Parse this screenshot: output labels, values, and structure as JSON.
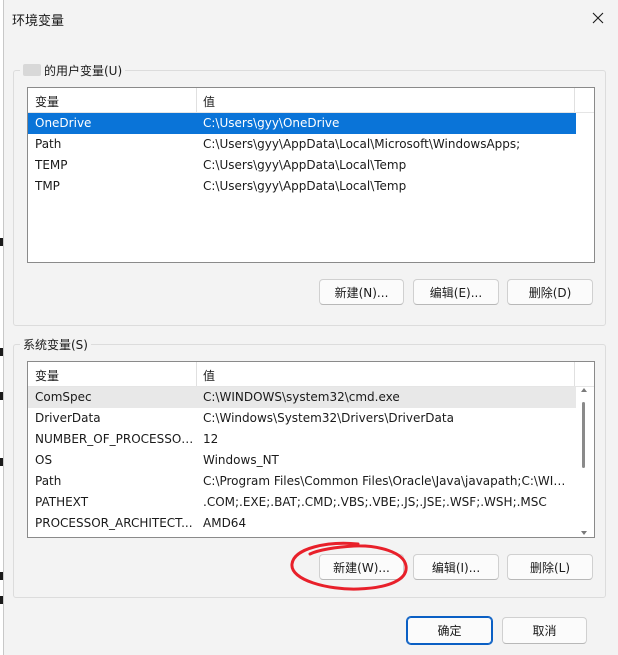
{
  "dialog": {
    "title": "环境变量"
  },
  "user_group": {
    "legend": "的用户变量(U)"
  },
  "system_group": {
    "legend": "系统变量(S)"
  },
  "columns": {
    "variable": "变量",
    "value": "值"
  },
  "user_vars": [
    {
      "name": "OneDrive",
      "value": "C:\\Users\\gyy\\OneDrive"
    },
    {
      "name": "Path",
      "value": "C:\\Users\\gyy\\AppData\\Local\\Microsoft\\WindowsApps;"
    },
    {
      "name": "TEMP",
      "value": "C:\\Users\\gyy\\AppData\\Local\\Temp"
    },
    {
      "name": "TMP",
      "value": "C:\\Users\\gyy\\AppData\\Local\\Temp"
    }
  ],
  "system_vars": [
    {
      "name": "ComSpec",
      "value": "C:\\WINDOWS\\system32\\cmd.exe"
    },
    {
      "name": "DriverData",
      "value": "C:\\Windows\\System32\\Drivers\\DriverData"
    },
    {
      "name": "NUMBER_OF_PROCESSORS",
      "value": "12"
    },
    {
      "name": "OS",
      "value": "Windows_NT"
    },
    {
      "name": "Path",
      "value": "C:\\Program Files\\Common Files\\Oracle\\Java\\javapath;C:\\WIN..."
    },
    {
      "name": "PATHEXT",
      "value": ".COM;.EXE;.BAT;.CMD;.VBS;.VBE;.JS;.JSE;.WSF;.WSH;.MSC"
    },
    {
      "name": "PROCESSOR_ARCHITECT...",
      "value": "AMD64"
    }
  ],
  "user_buttons": {
    "new": "新建(N)...",
    "edit": "编辑(E)...",
    "delete": "删除(D)"
  },
  "system_buttons": {
    "new": "新建(W)...",
    "edit": "编辑(I)...",
    "delete": "删除(L)"
  },
  "footer": {
    "ok": "确定",
    "cancel": "取消"
  },
  "icons": {
    "close": "close-icon"
  },
  "colors": {
    "selection": "#0a74d8",
    "annotation": "#e8202a",
    "primary_border": "#0a5fc4"
  }
}
